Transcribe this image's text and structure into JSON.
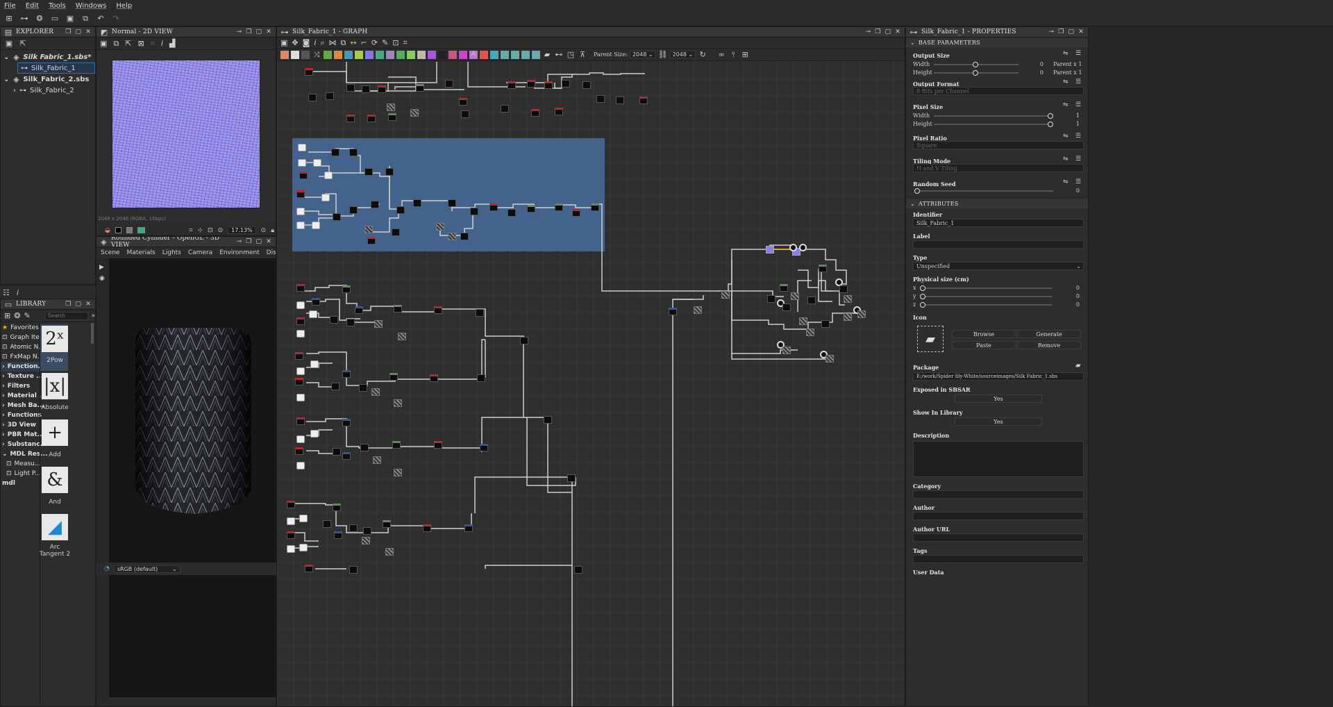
{
  "menu": [
    "File",
    "Edit",
    "Tools",
    "Windows",
    "Help"
  ],
  "explorer": {
    "title": "EXPLORER",
    "items": [
      {
        "label": "Silk Fabric_1.sbs*"
      },
      {
        "label": "Silk_Fabric_1"
      },
      {
        "label": "Silk_Fabric_2.sbs"
      },
      {
        "label": "Silk_Fabric_2"
      }
    ]
  },
  "view2d": {
    "title": "Normal - 2D VIEW",
    "info": "2048 x 2048 (RGBA, 16bpc)",
    "zoom": "17.13%"
  },
  "view3d": {
    "title": "Rounded Cylinder - OpenGL - 3D VIEW",
    "menu": [
      "Scene",
      "Materials",
      "Lights",
      "Camera",
      "Environment",
      "Display"
    ],
    "colorspace": "sRGB (default)"
  },
  "library": {
    "title": "LIBRARY",
    "search_placeholder": "Search",
    "categories": [
      {
        "label": "Favorites",
        "icon": "star-icon"
      },
      {
        "label": "Graph Ite...",
        "icon": "graph-icon"
      },
      {
        "label": "Atomic N...",
        "icon": "atomic-icon"
      },
      {
        "label": "FxMap N...",
        "icon": "fxmap-icon"
      },
      {
        "label": "Function...",
        "icon": "chevron-right-icon"
      },
      {
        "label": "Texture ...",
        "icon": "chevron-right-icon"
      },
      {
        "label": "Filters",
        "icon": "chevron-right-icon"
      },
      {
        "label": "Material ...",
        "icon": "chevron-right-icon"
      },
      {
        "label": "Mesh Ba...",
        "icon": "chevron-right-icon"
      },
      {
        "label": "Functions",
        "icon": "chevron-right-icon"
      },
      {
        "label": "3D View",
        "icon": "chevron-right-icon"
      },
      {
        "label": "PBR Mat...",
        "icon": "chevron-right-icon"
      },
      {
        "label": "Substanc...",
        "icon": "chevron-right-icon"
      },
      {
        "label": "MDL Res...",
        "icon": "chevron-down-icon"
      },
      {
        "label": "Measu...",
        "icon": "mdl-icon"
      },
      {
        "label": "Light P...",
        "icon": "mdl-icon"
      },
      {
        "label": "mdl",
        "icon": "none"
      }
    ],
    "tiles": [
      {
        "glyph": "2ˣ",
        "label": "2Pow"
      },
      {
        "glyph": "|x|",
        "label": "Absolute"
      },
      {
        "glyph": "+",
        "label": "Add"
      },
      {
        "glyph": "&",
        "label": "And"
      },
      {
        "glyph": "◢",
        "label": "Arc Tangent 2"
      }
    ]
  },
  "graph": {
    "title": "Silk_Fabric_1 - GRAPH",
    "parent_size_label": "Parent Size:",
    "size_w": "2048",
    "size_h": "2048"
  },
  "properties": {
    "title": "Silk_Fabric_1 - PROPERTIES",
    "base_section": "BASE PARAMETERS",
    "output_size": {
      "label": "Output Size",
      "width_label": "Width",
      "height_label": "Height",
      "width_val": "0",
      "height_val": "0",
      "width_mode": "Parent x 1",
      "height_mode": "Parent x 1"
    },
    "output_format": {
      "label": "Output Format",
      "value": "8 Bits per Channel"
    },
    "pixel_size": {
      "label": "Pixel Size",
      "width_label": "Width",
      "height_label": "Height",
      "width_val": "1",
      "height_val": "1"
    },
    "pixel_ratio": {
      "label": "Pixel Ratio",
      "value": "Square"
    },
    "tiling_mode": {
      "label": "Tiling Mode",
      "value": "H and V Tiling"
    },
    "random_seed": {
      "label": "Random Seed",
      "value": "0"
    },
    "attributes_section": "ATTRIBUTES",
    "identifier": {
      "label": "Identifier",
      "value": "Silk_Fabric_1"
    },
    "label_field": {
      "label": "Label",
      "value": ""
    },
    "type": {
      "label": "Type",
      "value": "Unspecified"
    },
    "physical_size": {
      "label": "Physical size (cm)",
      "x": "0",
      "y": "0",
      "z": "0"
    },
    "icon": {
      "label": "Icon",
      "browse": "Browse",
      "generate": "Generate",
      "paste": "Paste",
      "remove": "Remove"
    },
    "package": {
      "label": "Package",
      "value": "E:/work/Spider lily-White/sourceimages/Silk Fabric_1.sbs"
    },
    "exposed": {
      "label": "Exposed in SBSAR",
      "value": "Yes"
    },
    "show_library": {
      "label": "Show In Library",
      "value": "Yes"
    },
    "description": {
      "label": "Description"
    },
    "category": {
      "label": "Category"
    },
    "author": {
      "label": "Author"
    },
    "author_url": {
      "label": "Author URL"
    },
    "tags": {
      "label": "Tags"
    },
    "user_data": {
      "label": "User Data"
    }
  }
}
